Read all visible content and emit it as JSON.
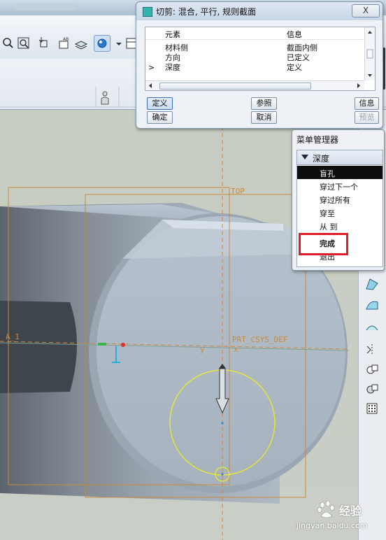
{
  "dialog": {
    "title": "切剪: 混合, 平行, 规则截面",
    "close_label": "X",
    "columns": [
      "元素",
      "信息"
    ],
    "rows": [
      {
        "marker": "",
        "element": "材料侧",
        "info": "截面内侧"
      },
      {
        "marker": "",
        "element": "方向",
        "info": "已定义"
      },
      {
        "marker": ">",
        "element": "深度",
        "info": "定义"
      }
    ],
    "buttons": {
      "define": "定义",
      "reference": "参照",
      "info": "信息",
      "ok": "确定",
      "cancel": "取消",
      "preview": "预览"
    }
  },
  "menu_manager": {
    "title": "菜单管理器",
    "section": "深度",
    "items": [
      {
        "label": "盲孔",
        "active": true
      },
      {
        "label": "穿过下一个",
        "active": false
      },
      {
        "label": "穿过所有",
        "active": false
      },
      {
        "label": "穿至",
        "active": false
      },
      {
        "label": "从 到",
        "active": false
      },
      {
        "label": "完成",
        "active": false
      },
      {
        "label": "退出",
        "active": false
      }
    ]
  },
  "viewport": {
    "datum_top": "TOP",
    "datum_a": "A_1",
    "csys": "PRT_CSYS_DEF",
    "axis_y": "y",
    "axis_x": "x"
  },
  "watermark": {
    "brand": "Baidu",
    "text": "经验",
    "url": "jingyan.baidu.com"
  },
  "colors": {
    "highlight": "#e01c2a",
    "menu_active_bg": "#0e0e0e",
    "datum_orange": "#d08a3a",
    "sketch_yellow": "#f2ef2a",
    "part_body": "#aab7c3"
  }
}
